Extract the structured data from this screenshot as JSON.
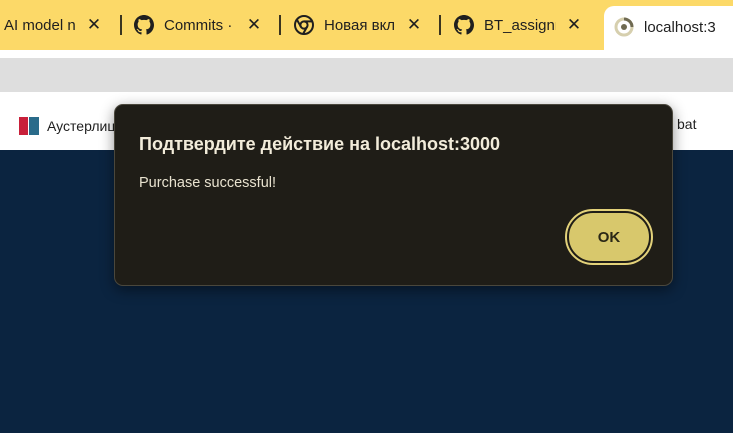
{
  "tabs": [
    {
      "title": "AI model n",
      "icon": "page-icon",
      "active": false
    },
    {
      "title": "Commits ·",
      "icon": "github-icon",
      "active": false
    },
    {
      "title": "Новая вкл",
      "icon": "chrome-icon",
      "active": false
    },
    {
      "title": "BT_assignm",
      "icon": "github-icon",
      "active": false
    },
    {
      "title": "localhost:3",
      "icon": "loading-icon",
      "active": true
    }
  ],
  "tab_close_glyph": "✕",
  "bookmarks": {
    "items": [
      {
        "label": "Аустерлиц",
        "icon": "bookmark-flag-icon"
      },
      {
        "label": "bat",
        "icon": ""
      }
    ]
  },
  "dialog": {
    "title": "Подтвердите действие на localhost:3000",
    "message": "Purchase successful!",
    "ok_label": "OK"
  },
  "colors": {
    "tabstrip_bg": "#fcd968",
    "page_bg": "#0b2440",
    "dialog_bg": "#1f1d17",
    "ok_button": "#d8c86c"
  }
}
